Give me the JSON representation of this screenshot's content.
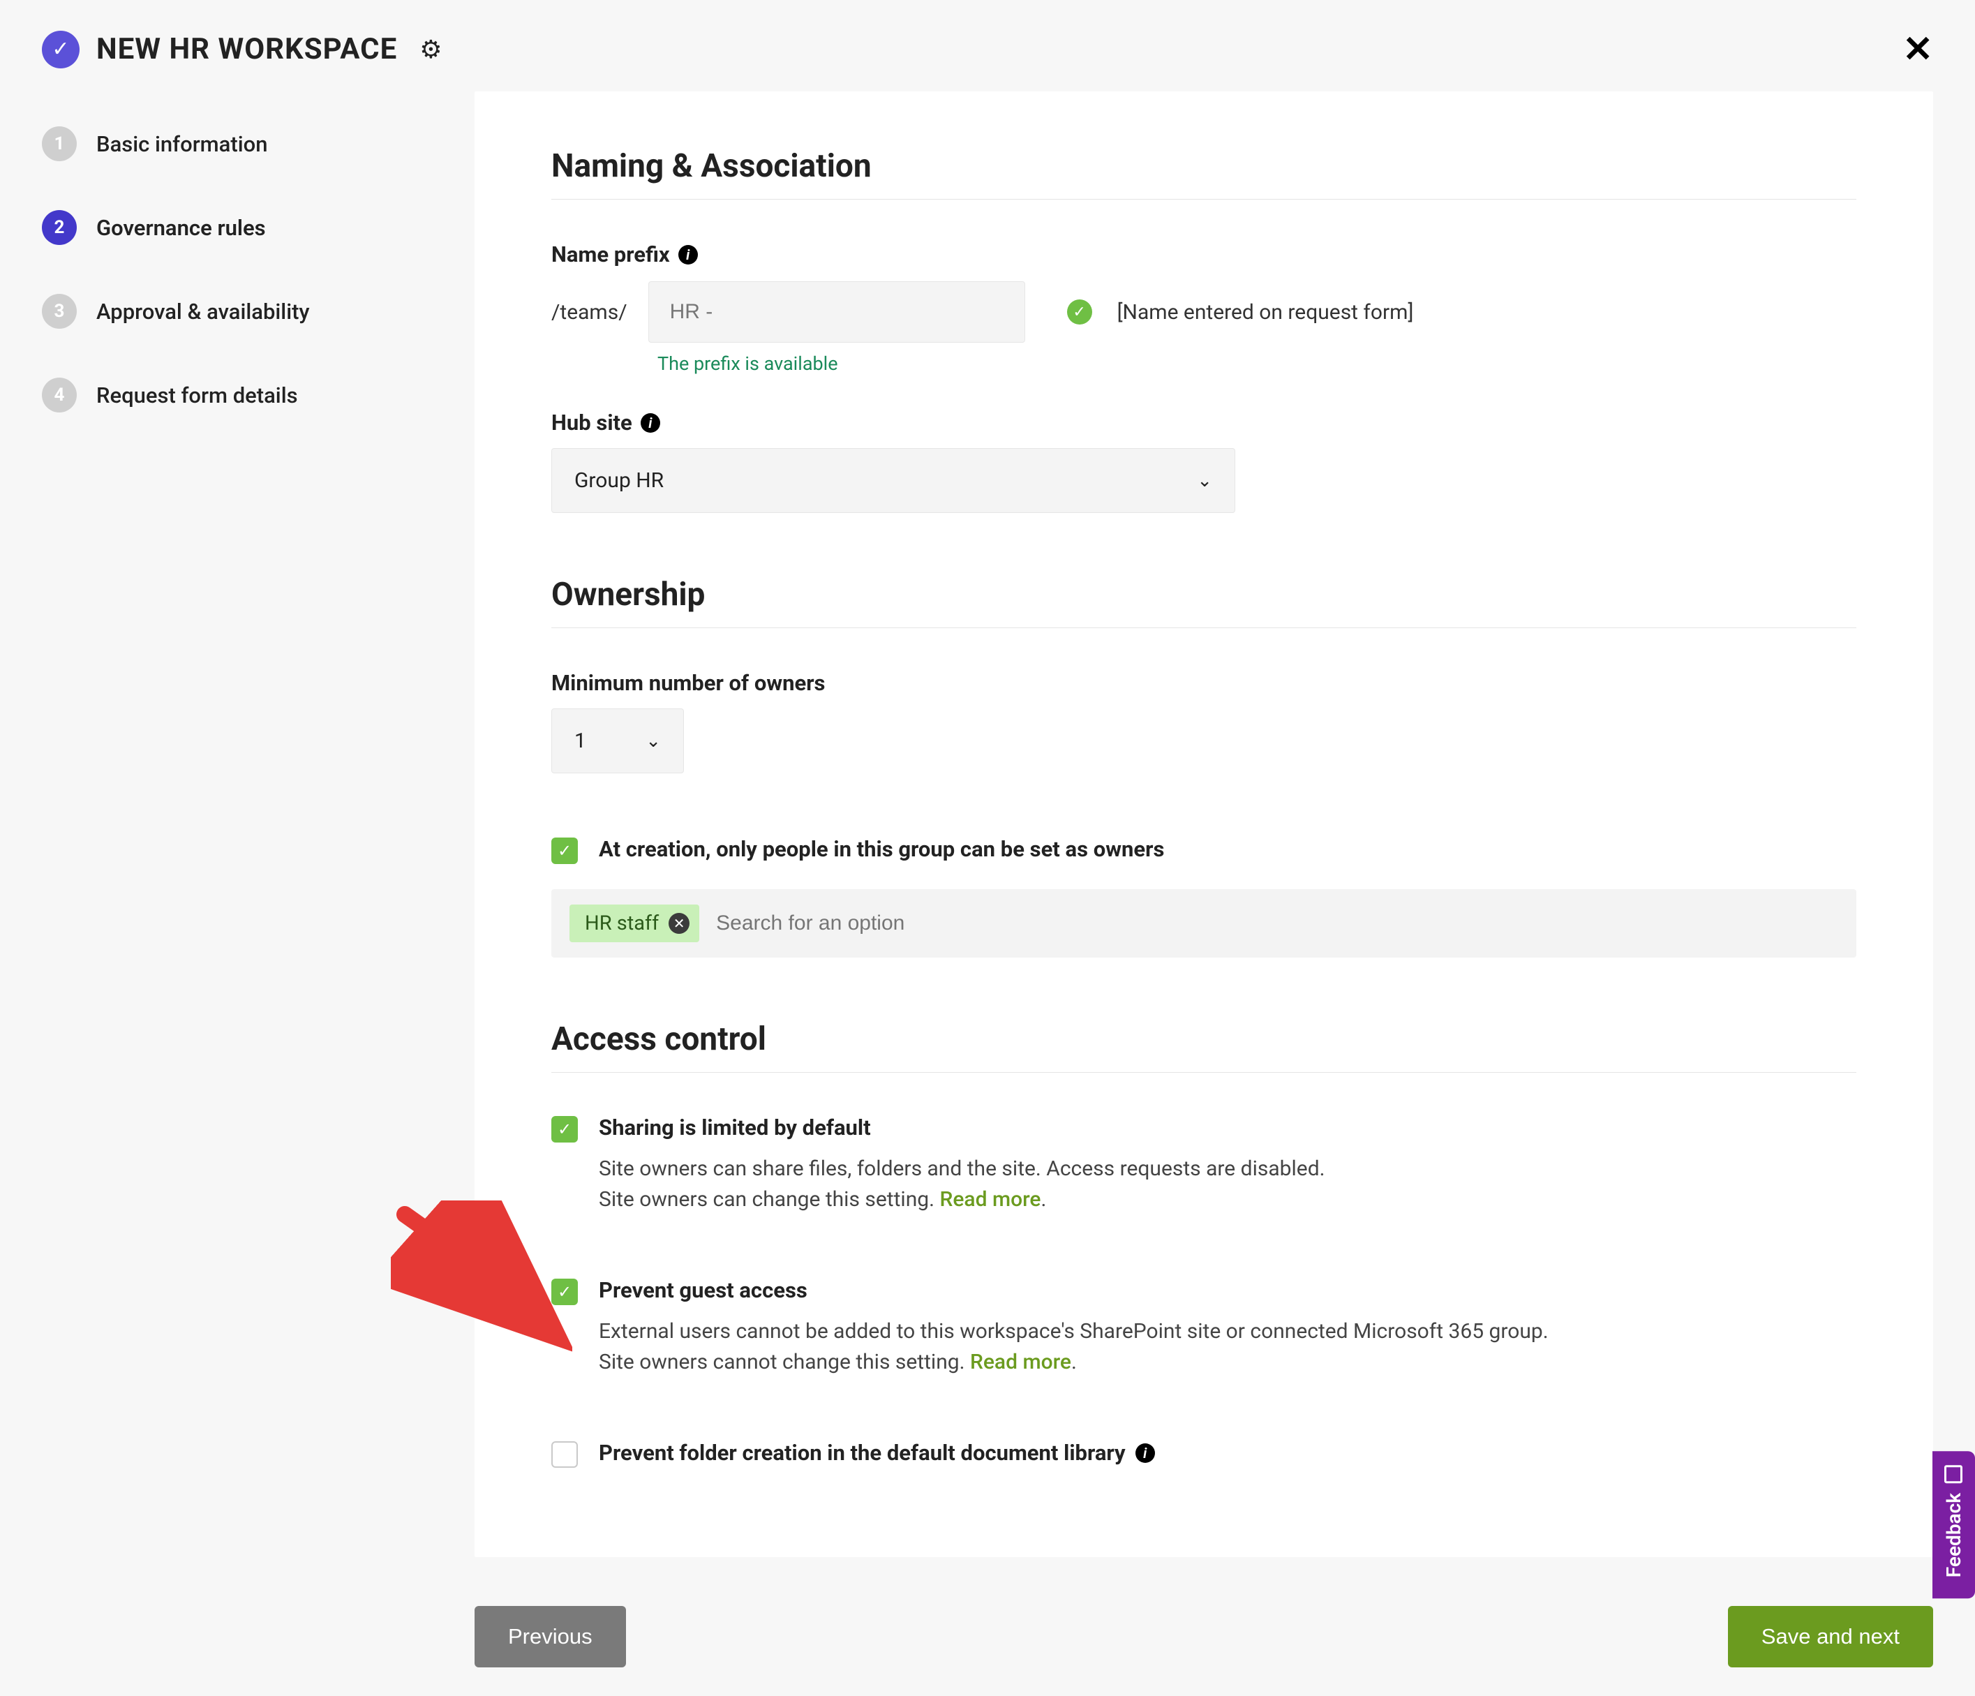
{
  "header": {
    "title": "NEW HR WORKSPACE"
  },
  "steps": [
    {
      "num": "1",
      "label": "Basic information",
      "active": false
    },
    {
      "num": "2",
      "label": "Governance rules",
      "active": true
    },
    {
      "num": "3",
      "label": "Approval & availability",
      "active": false
    },
    {
      "num": "4",
      "label": "Request form details",
      "active": false
    }
  ],
  "naming": {
    "section_title": "Naming & Association",
    "name_prefix_label": "Name prefix",
    "teams_path": "/teams/",
    "prefix_value": "HR -",
    "name_entered_text": "[Name entered on request form]",
    "prefix_available_msg": "The prefix is available",
    "hub_label": "Hub site",
    "hub_value": "Group HR"
  },
  "ownership": {
    "section_title": "Ownership",
    "min_owners_label": "Minimum number of owners",
    "min_owners_value": "1",
    "checkbox_label": "At creation, only people in this group can be set as owners",
    "tag": "HR staff",
    "search_placeholder": "Search for an option"
  },
  "access": {
    "section_title": "Access control",
    "sharing_label": "Sharing is limited by default",
    "sharing_desc1": "Site owners can share files, folders and the site. Access requests are disabled.",
    "sharing_desc2a": "Site owners can change this setting. ",
    "guest_label": "Prevent guest access",
    "guest_desc1": "External users cannot be added to this workspace's SharePoint site or connected Microsoft 365 group.",
    "guest_desc2a": "Site owners cannot change this setting. ",
    "folder_label": "Prevent folder creation in the default document library",
    "read_more": "Read more"
  },
  "footer": {
    "previous": "Previous",
    "save_next": "Save and next"
  },
  "feedback": "Feedback"
}
